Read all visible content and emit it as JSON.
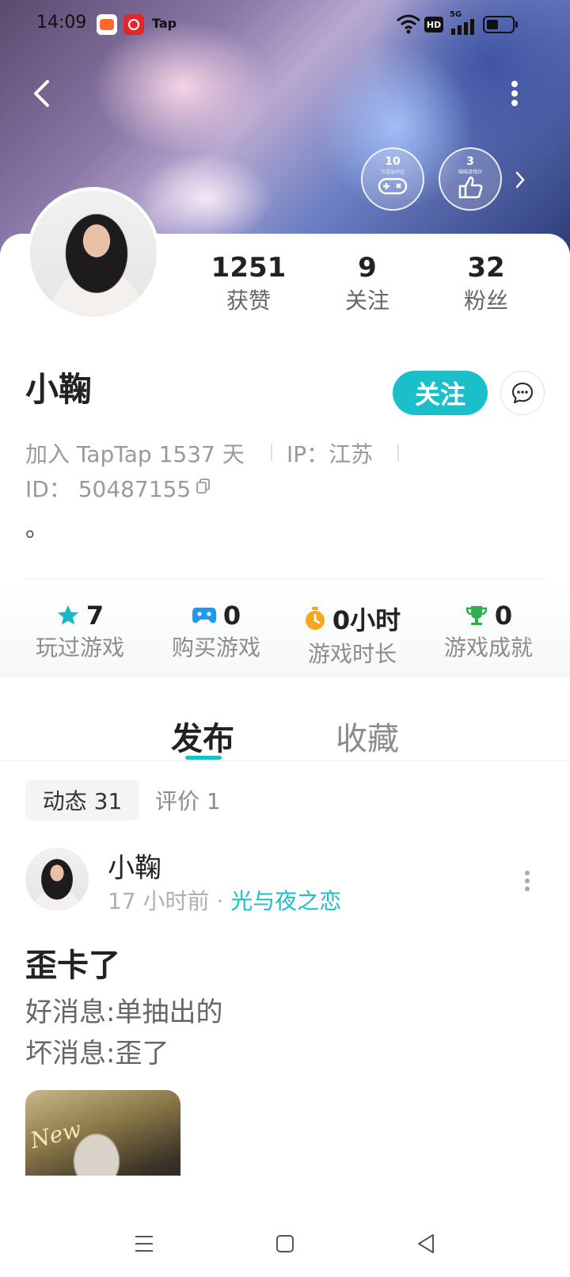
{
  "status_bar": {
    "time": "14:09",
    "tap_label": "Tap",
    "hd_label": "HD",
    "net_label": "5G"
  },
  "badges": [
    {
      "num": "10",
      "caption": "万花丛中过"
    },
    {
      "num": "3",
      "caption": "喵喵游戏好"
    }
  ],
  "stats": [
    {
      "value": "1251",
      "label": "获赞"
    },
    {
      "value": "9",
      "label": "关注"
    },
    {
      "value": "32",
      "label": "粉丝"
    }
  ],
  "profile": {
    "name": "小鞠",
    "follow_label": "关注",
    "joined": "加入 TapTap 1537 天",
    "ip": "IP：江苏",
    "id": "ID：  50487155",
    "bio": "。"
  },
  "game_stats": [
    {
      "value": "7",
      "label": "玩过游戏",
      "icon": "star-icon",
      "color": "#14b9c8"
    },
    {
      "value": "0",
      "label": "购买游戏",
      "icon": "gamepad-icon",
      "color": "#1e9bf0"
    },
    {
      "value": "0小时",
      "label": "游戏时长",
      "icon": "stopwatch-icon",
      "color": "#f5a623"
    },
    {
      "value": "0",
      "label": "游戏成就",
      "icon": "trophy-icon",
      "color": "#2bb24c"
    }
  ],
  "tabs": [
    {
      "label": "发布",
      "active": true
    },
    {
      "label": "收藏",
      "active": false
    }
  ],
  "chips": [
    {
      "label": "动态 31",
      "active": true
    },
    {
      "label": "评价 1",
      "active": false
    }
  ],
  "post": {
    "author": "小鞠",
    "time": "17 小时前",
    "separator": "·",
    "game": "光与夜之恋",
    "title": "歪卡了",
    "lines": [
      "好消息:单抽出的",
      "坏消息:歪了"
    ],
    "image_text": "New"
  },
  "colors": {
    "accent": "#1bbfc9"
  }
}
